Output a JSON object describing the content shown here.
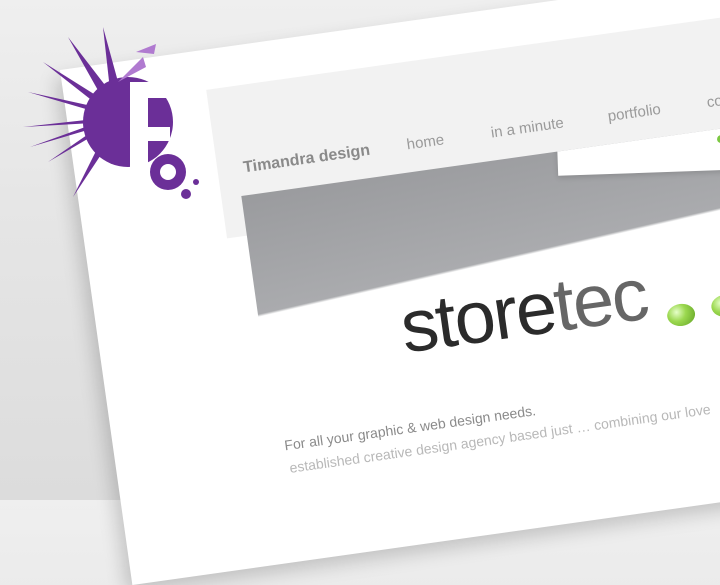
{
  "header": {
    "brand": "Timandra design"
  },
  "nav": {
    "items": [
      "home",
      "in a minute",
      "portfolio",
      "co"
    ]
  },
  "hero": {
    "card_text": "store",
    "logo_bold": "store",
    "logo_light": "tec",
    "ball_color": "#7cc842"
  },
  "content": {
    "tagline": "For all your graphic & web design needs.",
    "intro": "established creative design agency based just … combining our love"
  },
  "colors": {
    "accent": "#6b2f98",
    "secondary": "#b07ad0"
  }
}
